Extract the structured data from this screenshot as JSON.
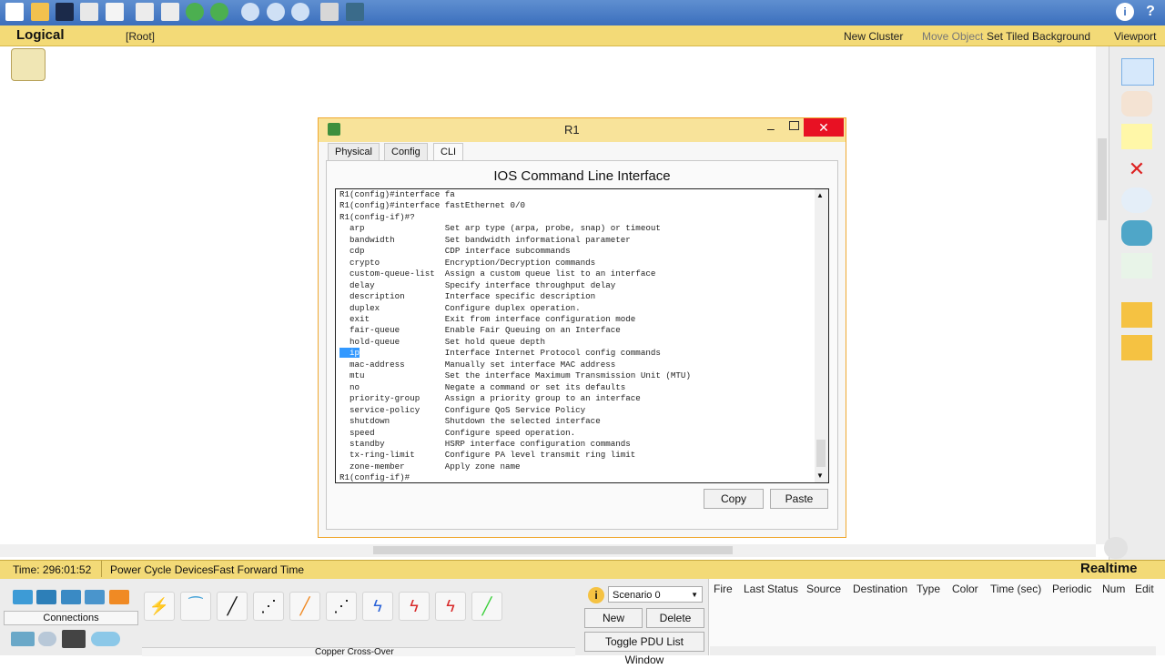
{
  "logical_bar": {
    "mode_label": "Logical",
    "root_label": "[Root]",
    "new_cluster": "New Cluster",
    "move_object": "Move Object",
    "set_tiled_background": "Set Tiled Background",
    "viewport": "Viewport"
  },
  "window": {
    "title": "R1",
    "tabs": [
      "Physical",
      "Config",
      "CLI"
    ],
    "active_tab": "CLI",
    "heading": "IOS Command Line Interface",
    "copy_label": "Copy",
    "paste_label": "Paste"
  },
  "terminal": {
    "lines": [
      [
        "R1(config)#interface fa",
        ""
      ],
      [
        "R1(config)#interface fastEthernet 0/0",
        ""
      ],
      [
        "R1(config-if)#?",
        ""
      ],
      [
        "  arp",
        "Set arp type (arpa, probe, snap) or timeout"
      ],
      [
        "  bandwidth",
        "Set bandwidth informational parameter"
      ],
      [
        "  cdp",
        "CDP interface subcommands"
      ],
      [
        "  crypto",
        "Encryption/Decryption commands"
      ],
      [
        "  custom-queue-list",
        "Assign a custom queue list to an interface"
      ],
      [
        "  delay",
        "Specify interface throughput delay"
      ],
      [
        "  description",
        "Interface specific description"
      ],
      [
        "  duplex",
        "Configure duplex operation."
      ],
      [
        "  exit",
        "Exit from interface configuration mode"
      ],
      [
        "  fair-queue",
        "Enable Fair Queuing on an Interface"
      ],
      [
        "  hold-queue",
        "Set hold queue depth"
      ],
      [
        "  ip",
        "Interface Internet Protocol config commands"
      ],
      [
        "  mac-address",
        "Manually set interface MAC address"
      ],
      [
        "  mtu",
        "Set the interface Maximum Transmission Unit (MTU)"
      ],
      [
        "  no",
        "Negate a command or set its defaults"
      ],
      [
        "  priority-group",
        "Assign a priority group to an interface"
      ],
      [
        "  service-policy",
        "Configure QoS Service Policy"
      ],
      [
        "  shutdown",
        "Shutdown the selected interface"
      ],
      [
        "  speed",
        "Configure speed operation."
      ],
      [
        "  standby",
        "HSRP interface configuration commands"
      ],
      [
        "  tx-ring-limit",
        "Configure PA level transmit ring limit"
      ],
      [
        "  zone-member",
        "Apply zone name"
      ],
      [
        "R1(config-if)#",
        ""
      ]
    ],
    "highlighted_line": 14
  },
  "status_bar": {
    "time": "Time: 296:01:52",
    "power_cycle": "Power Cycle Devices",
    "fast_forward": "Fast Forward Time",
    "mode": "Realtime"
  },
  "bottom": {
    "connections_label": "Connections",
    "cable_tooltip": "Copper Cross-Over",
    "scenario": "Scenario 0",
    "new_label": "New",
    "delete_label": "Delete",
    "toggle_label": "Toggle PDU List Window",
    "pdu_headers": [
      "Fire",
      "Last Status",
      "Source",
      "Destination",
      "Type",
      "Color",
      "Time (sec)",
      "Periodic",
      "Num",
      "Edit"
    ]
  },
  "colors": {
    "toolbar": "#3b6fbd",
    "yellow_bar": "#f3da77",
    "window_border": "#f0a830",
    "close": "#e81123",
    "selection": "#3399ff"
  }
}
